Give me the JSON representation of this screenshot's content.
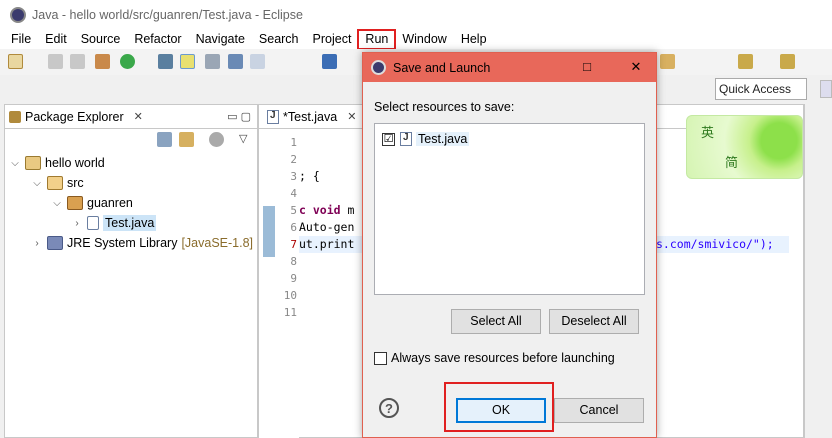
{
  "window": {
    "title": "Java - hello world/src/guanren/Test.java - Eclipse"
  },
  "menubar": [
    "File",
    "Edit",
    "Source",
    "Refactor",
    "Navigate",
    "Search",
    "Project",
    "Run",
    "Window",
    "Help"
  ],
  "toolbar": {
    "quick_access": "Quick Access"
  },
  "package_explorer": {
    "tab_label": "Package Explorer",
    "tree": {
      "project": "hello world",
      "src": "src",
      "package": "guanren",
      "file": "Test.java",
      "jre": "JRE System Library",
      "jre_version": "[JavaSE-1.8]"
    }
  },
  "editor": {
    "tab_label": "*Test.java",
    "line_numbers": [
      "1",
      "2",
      "3",
      "4",
      "5",
      "6",
      "7",
      "8",
      "9",
      "10",
      "11"
    ],
    "code": {
      "line3": "; {",
      "line5_kw": "c void",
      "line5_rest": " m",
      "line6": "Auto-gen",
      "line7_start": "ut.print",
      "line7_str": "s.com/smivico/\");"
    }
  },
  "decoration": {
    "char1": "英",
    "char2": "简"
  },
  "dialog": {
    "title": "Save and Launch",
    "minimize": "□",
    "close": "✕",
    "select_label": "Select resources to save:",
    "resources": [
      {
        "name": "Test.java",
        "checked": "☑"
      }
    ],
    "select_all": "Select All",
    "deselect_all": "Deselect All",
    "always_save": "Always save resources before launching",
    "help": "?",
    "ok": "OK",
    "cancel": "Cancel"
  }
}
